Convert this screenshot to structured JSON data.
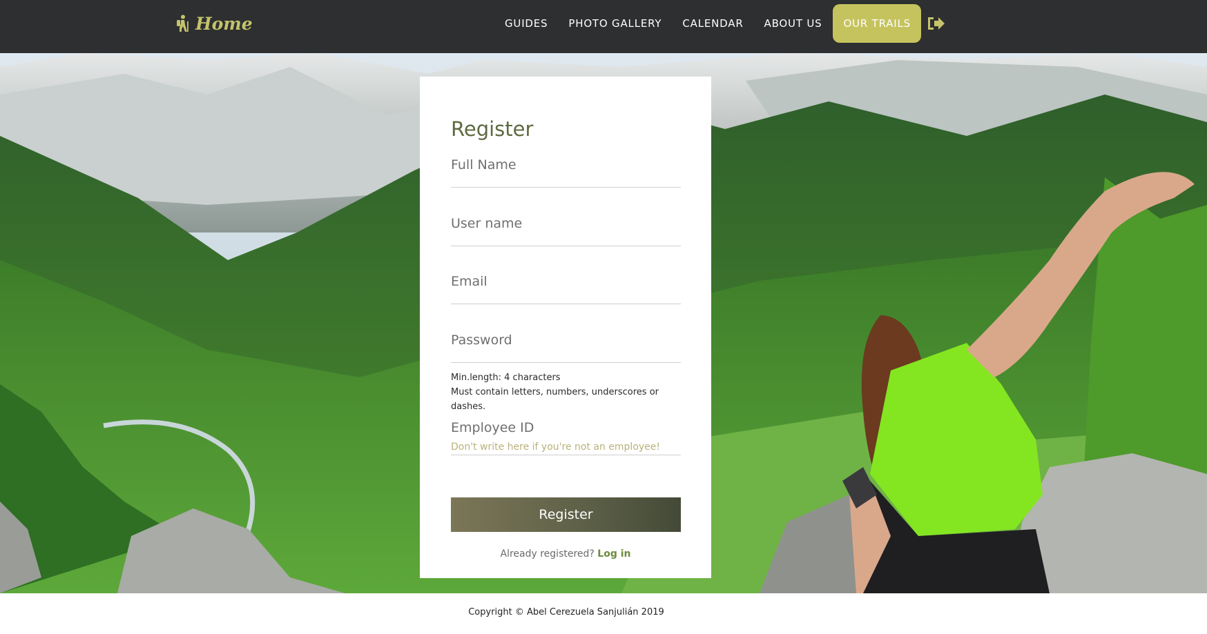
{
  "header": {
    "brand_label": "Home",
    "nav": [
      {
        "label": "GUIDES"
      },
      {
        "label": "PHOTO GALLERY"
      },
      {
        "label": "CALENDAR"
      },
      {
        "label": "ABOUT US"
      },
      {
        "label": "OUR TRAILS",
        "active": true
      }
    ],
    "logout_icon": "sign-out-icon",
    "brand_icon": "hiker-icon"
  },
  "form": {
    "title": "Register",
    "fields": {
      "full_name": {
        "placeholder": "Full Name",
        "value": ""
      },
      "user_name": {
        "placeholder": "User name",
        "value": ""
      },
      "email": {
        "placeholder": "Email",
        "value": ""
      },
      "password": {
        "placeholder": "Password",
        "value": ""
      }
    },
    "password_hint_1": "Min.length: 4 characters",
    "password_hint_2": "Must contain letters, numbers, underscores or dashes.",
    "employee_id": {
      "label": "Employee ID",
      "placeholder": "Don't write here if you're not an employee!"
    },
    "submit_label": "Register",
    "already_text": "Already registered?",
    "login_link": "Log in"
  },
  "footer": {
    "copyright": "Copyright © Abel Cerezuela Sanjulián 2019"
  },
  "colors": {
    "header_bg": "#2d2f30",
    "accent": "#c5c35e",
    "title_green": "#5d6a40",
    "button_start": "#7c7658",
    "button_end": "#444a38",
    "link_green": "#6b8a3a"
  }
}
